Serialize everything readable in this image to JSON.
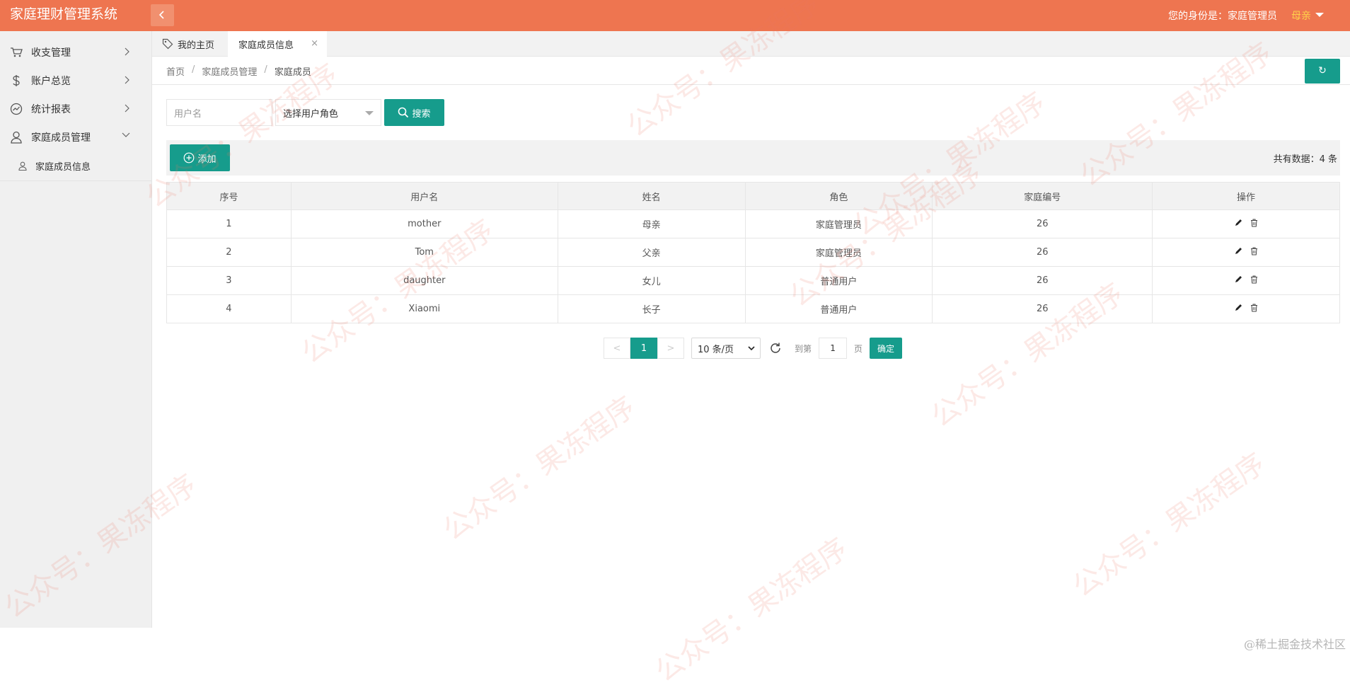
{
  "app": {
    "title": "家庭理财管理系统"
  },
  "header": {
    "identity_label": "您的身份是：家庭管理员",
    "user_name": "母亲"
  },
  "sidebar": {
    "items": [
      {
        "label": "收支管理",
        "icon": "cart-icon"
      },
      {
        "label": "账户总览",
        "icon": "dollar-icon"
      },
      {
        "label": "统计报表",
        "icon": "chart-icon"
      },
      {
        "label": "家庭成员管理",
        "icon": "user-icon"
      }
    ],
    "subitems": [
      {
        "label": "家庭成员信息",
        "icon": "user-icon"
      }
    ]
  },
  "tabs": {
    "home": "我的主页",
    "active": "家庭成员信息",
    "close": "×"
  },
  "breadcrumb": {
    "items": [
      "首页",
      "家庭成员管理",
      "家庭成员"
    ],
    "sep": "/"
  },
  "refresh_button": {
    "label": "↻"
  },
  "search": {
    "username_placeholder": "用户名",
    "role_select": "选择用户角色",
    "button": "搜索"
  },
  "toolbar": {
    "add_button": "添加",
    "total": "共有数据：4 条"
  },
  "table": {
    "headers": [
      "序号",
      "用户名",
      "姓名",
      "角色",
      "家庭编号",
      "操作"
    ],
    "rows": [
      [
        "1",
        "mother",
        "母亲",
        "家庭管理员",
        "26"
      ],
      [
        "2",
        "Tom",
        "父亲",
        "家庭管理员",
        "26"
      ],
      [
        "3",
        "daughter",
        "女儿",
        "普通用户",
        "26"
      ],
      [
        "4",
        "Xiaomi",
        "长子",
        "普通用户",
        "26"
      ]
    ]
  },
  "pagination": {
    "prev": "<",
    "current": "1",
    "next": ">",
    "page_size": "10 条/页",
    "goto_label": "到第",
    "goto_value": "1",
    "page_unit": "页",
    "confirm": "确定"
  },
  "watermark": {
    "text": "公众号：果冻程序"
  },
  "footer": {
    "mark": "@稀土掘金技术社区"
  },
  "colors": {
    "header": "#ee7550",
    "primary": "#169c8c",
    "user": "#ffd24a"
  }
}
